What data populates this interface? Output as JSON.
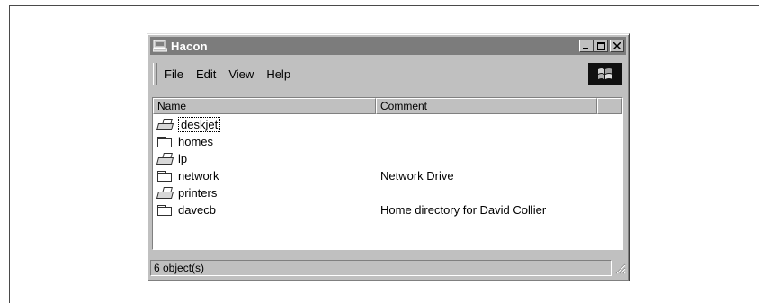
{
  "window": {
    "title": "Hacon",
    "controls": {
      "minimize": "_",
      "maximize": "□",
      "close": "×"
    }
  },
  "menu": {
    "items": [
      {
        "label": "File"
      },
      {
        "label": "Edit"
      },
      {
        "label": "View"
      },
      {
        "label": "Help"
      }
    ]
  },
  "list": {
    "columns": {
      "name": "Name",
      "comment": "Comment"
    },
    "rows": [
      {
        "name": "deskjet",
        "comment": "",
        "icon": "printer-icon"
      },
      {
        "name": "homes",
        "comment": "",
        "icon": "folder-icon"
      },
      {
        "name": "lp",
        "comment": "",
        "icon": "printer-icon"
      },
      {
        "name": "network",
        "comment": "Network Drive",
        "icon": "folder-icon"
      },
      {
        "name": "printers",
        "comment": "",
        "icon": "printer-icon"
      },
      {
        "name": "davecb",
        "comment": "Home directory for David Collier",
        "icon": "folder-icon"
      }
    ]
  },
  "status": {
    "text": "6 object(s)"
  },
  "colors": {
    "titlebar": "#7c7c7c",
    "face": "#c0c0c0",
    "window_bg": "#ffffff"
  }
}
